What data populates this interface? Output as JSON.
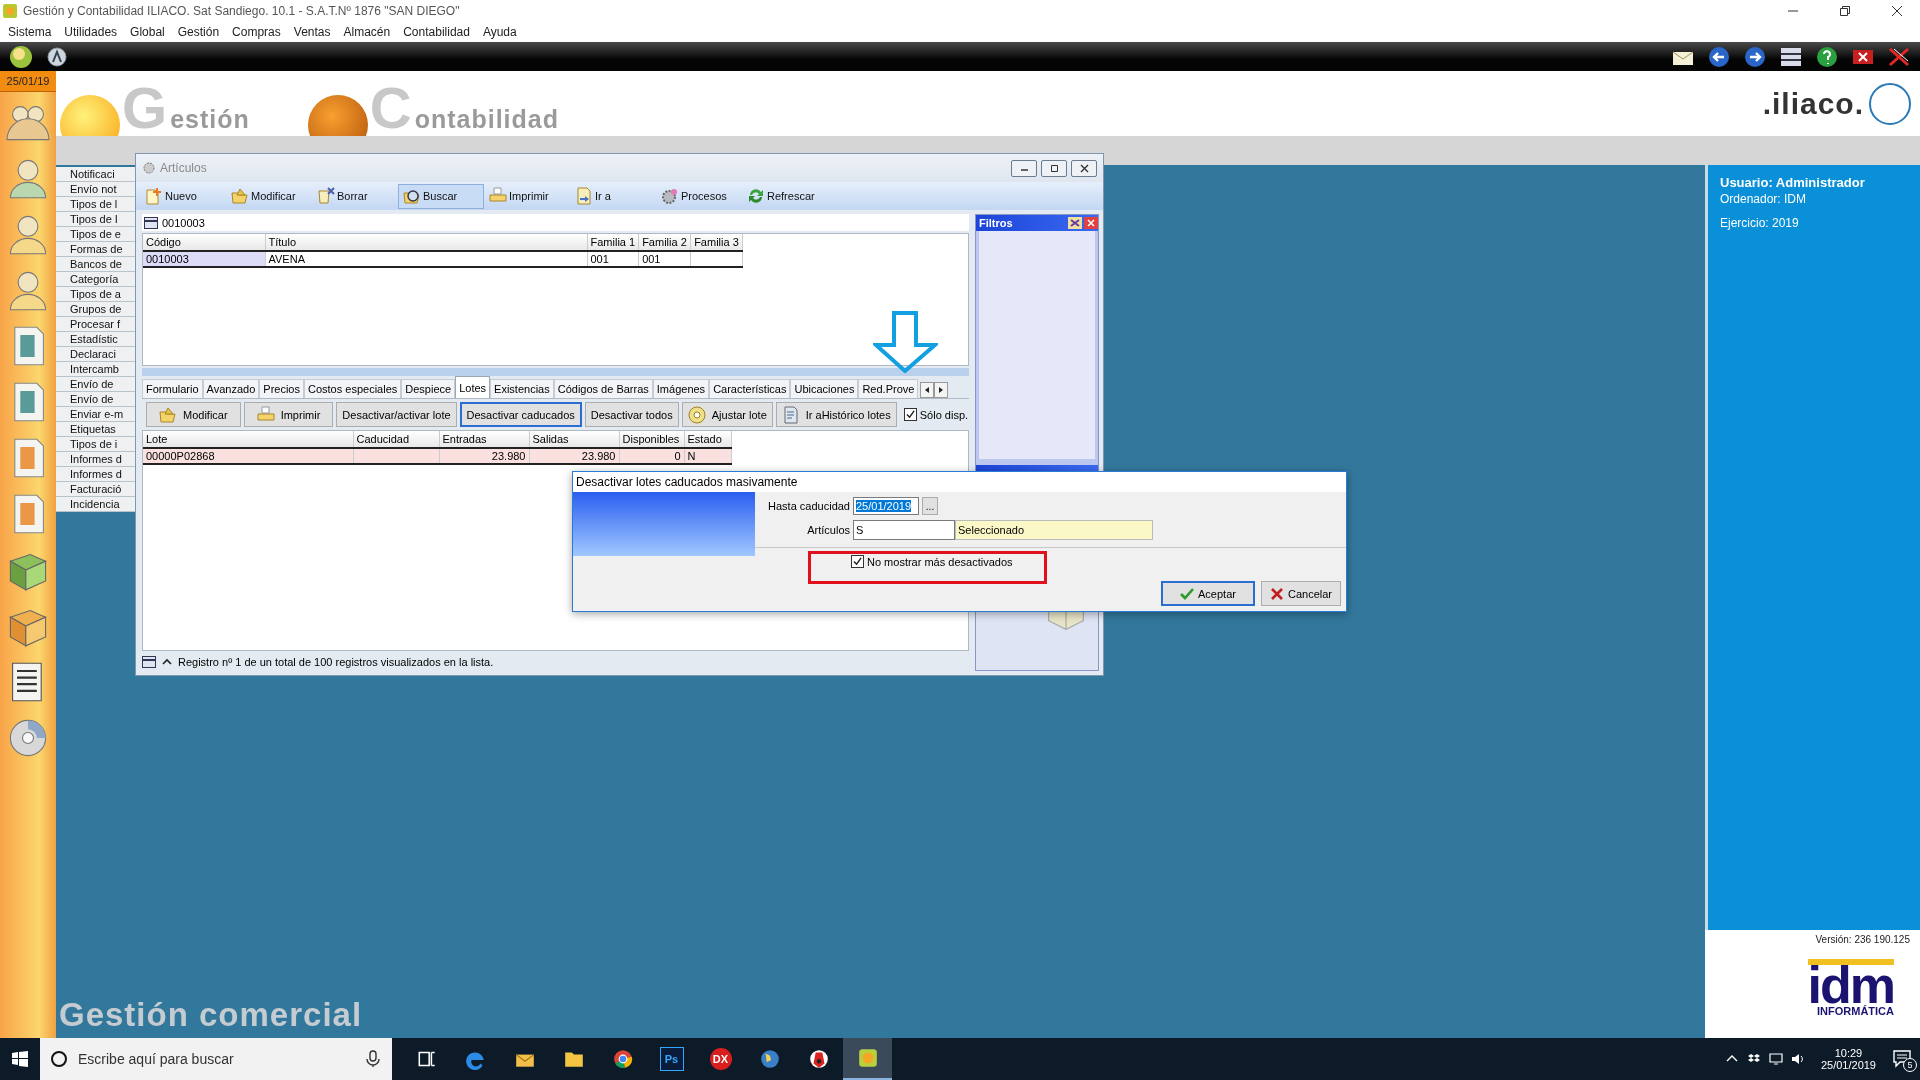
{
  "window": {
    "title": "Gestión y Contabilidad ILIACO. Sat Sandiego. 10.1 - S.A.T.Nº  1876 \"SAN DIEGO\""
  },
  "menu": [
    "Sistema",
    "Utilidades",
    "Global",
    "Gestión",
    "Compras",
    "Ventas",
    "Almacén",
    "Contabilidad",
    "Ayuda"
  ],
  "date_badge": "25/01/19",
  "header": {
    "gestion_initial": "G",
    "gestion_rest": "estión",
    "contab_initial": "C",
    "contab_rest": "ontabilidad",
    "brand": ".iliaco."
  },
  "side_list": [
    "Notificaci",
    "Envío not",
    "Tipos de l",
    "Tipos de I",
    "Tipos de e",
    "Formas de",
    "Bancos de",
    "Categoría",
    "Tipos de a",
    "Grupos de",
    "Procesar f",
    "Estadístic",
    "Declaraci",
    "Intercamb",
    "Envío de",
    "Envío de",
    "Enviar e-m",
    "Etiquetas",
    "Tipos de i",
    "Informes d",
    "Informes d",
    "Facturació",
    "Incidencia"
  ],
  "articulos": {
    "title": "Artículos",
    "toolbar": [
      {
        "label": "Nuevo",
        "kind": "new",
        "selected": false
      },
      {
        "label": "Modificar",
        "kind": "edit",
        "selected": false
      },
      {
        "label": "Borrar",
        "kind": "delete",
        "selected": false
      },
      {
        "label": "Buscar",
        "kind": "search",
        "selected": true
      },
      {
        "label": "Imprimir",
        "kind": "print",
        "selected": false
      },
      {
        "label": "Ir a",
        "kind": "goto",
        "selected": false
      },
      {
        "label": "Procesos",
        "kind": "process",
        "selected": false
      },
      {
        "label": "Refrescar",
        "kind": "refresh",
        "selected": false
      }
    ],
    "code": "0010003",
    "grid": {
      "columns": [
        "Código",
        "Título",
        "Familia 1",
        "Familia 2",
        "Familia 3"
      ],
      "rows": [
        {
          "cells": [
            "0010003",
            "AVENA",
            "001",
            "001",
            null
          ],
          "selected": true
        }
      ]
    },
    "tabs": [
      {
        "label": "Formulario",
        "selected": false
      },
      {
        "label": "Avanzado",
        "selected": false
      },
      {
        "label": "Precios",
        "selected": false
      },
      {
        "label": "Costos especiales",
        "selected": false
      },
      {
        "label": "Despiece",
        "selected": false
      },
      {
        "label": "Lotes",
        "selected": true
      },
      {
        "label": "Existencias",
        "selected": false
      },
      {
        "label": "Códigos de Barras",
        "selected": false
      },
      {
        "label": "Imágenes",
        "selected": false
      },
      {
        "label": "Características",
        "selected": false
      },
      {
        "label": "Ubicaciones",
        "selected": false
      },
      {
        "label": "Red.Prove",
        "selected": false
      }
    ],
    "lotes_toolbar": [
      {
        "label": "Modificar",
        "kind": "edit",
        "focused": false
      },
      {
        "label": "Imprimir",
        "kind": "print",
        "focused": false
      },
      {
        "label": "Desactivar/activar lote",
        "kind": "plain",
        "focused": false
      },
      {
        "label": "Desactivar caducados",
        "kind": "plain",
        "focused": true
      },
      {
        "label": "Desactivar todos",
        "kind": "plain",
        "focused": false
      },
      {
        "label": "Ajustar lote",
        "kind": "adjust",
        "focused": false
      },
      {
        "label": "Ir aHistórico lotes",
        "kind": "history",
        "focused": false
      }
    ],
    "solo_disp": {
      "label": "Sólo disp.",
      "checked": true
    },
    "lotes_grid": {
      "columns": [
        "Lote",
        "Caducidad",
        "Entradas",
        "Salidas",
        "Disponibles",
        "Estado"
      ],
      "rows": [
        {
          "cells": [
            "00000P02868",
            null,
            "23.980",
            "23.980",
            "0",
            "N"
          ],
          "selected": true
        }
      ]
    },
    "status": "Registro nº 1 de un total de 100 registros visualizados en la lista.",
    "filtros": {
      "title": "Filtros"
    }
  },
  "dialog": {
    "title": "Desactivar lotes caducados masivamente",
    "hasta_label": "Hasta caducidad",
    "hasta_value": "25/01/2019",
    "browse": "...",
    "articulos_label": "Artículos",
    "articulos_value": "S",
    "articulos_desc": "Seleccionado",
    "no_mostrar": {
      "label": "No mostrar más desactivados",
      "checked": true
    },
    "accept": "Aceptar",
    "cancel": "Cancelar"
  },
  "user_panel": {
    "usuario": "Usuario: Administrador",
    "ordenador": "Ordenador: IDM",
    "ejercicio": "Ejercicio: 2019",
    "version": "Versión: 236 190.125",
    "logo_main": "idm",
    "logo_sub": "INFORMÁTICA"
  },
  "footer_title": "Gestión comercial",
  "taskbar": {
    "search_placeholder": "Escribe aquí para buscar",
    "apps": [
      {
        "kind": "taskview",
        "selected": false
      },
      {
        "kind": "edge",
        "selected": false
      },
      {
        "kind": "mail",
        "selected": false
      },
      {
        "kind": "folder",
        "selected": false
      },
      {
        "kind": "chrome",
        "selected": false
      },
      {
        "kind": "ps",
        "label": "Ps",
        "selected": false
      },
      {
        "kind": "dx",
        "label": "DX",
        "selected": false
      },
      {
        "kind": "globe",
        "selected": false
      },
      {
        "kind": "bird",
        "selected": false
      },
      {
        "kind": "iliaco",
        "selected": true
      }
    ],
    "time": "10:29",
    "date": "25/01/2019",
    "notifications": "5"
  }
}
